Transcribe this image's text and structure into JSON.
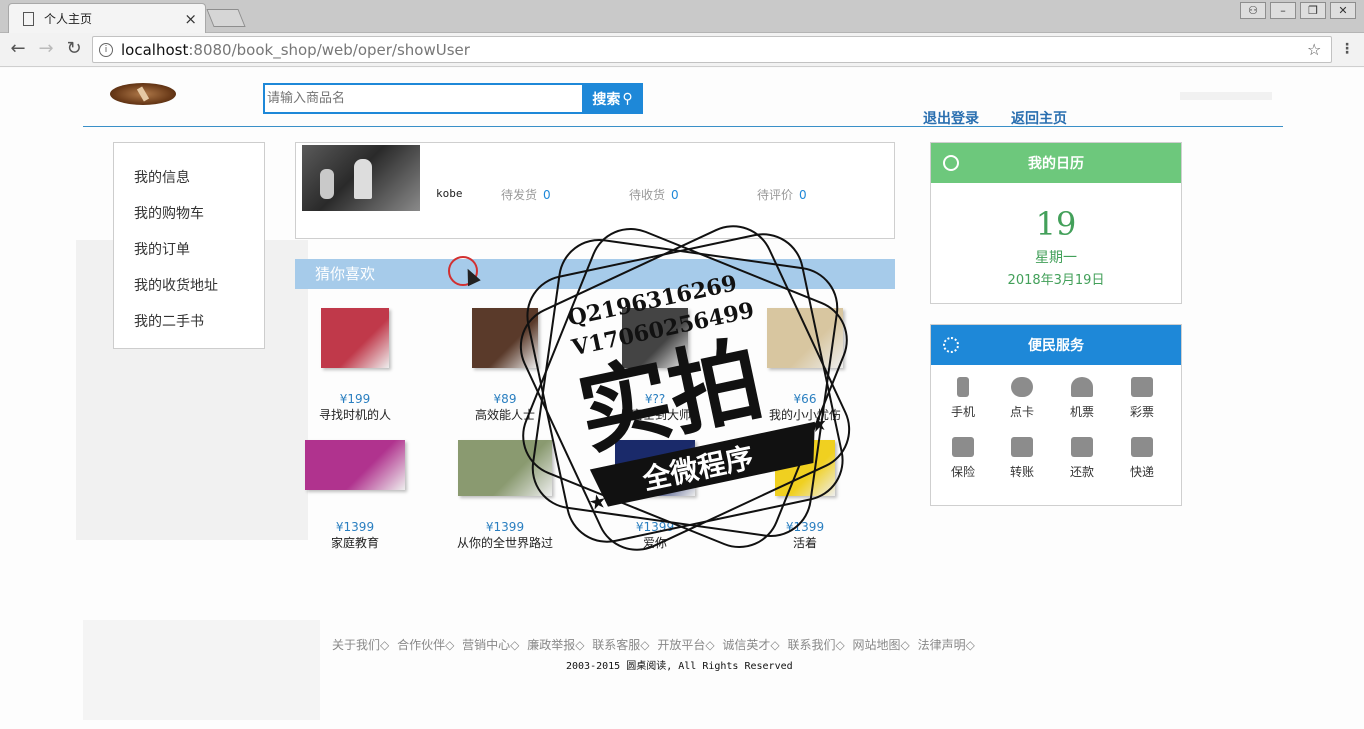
{
  "browser": {
    "tab_title": "个人主页",
    "tab_close": "×",
    "url_host": "localhost",
    "url_path": ":8080/book_shop/web/oper/showUser"
  },
  "header": {
    "search_placeholder": "请输入商品名",
    "search_button": "搜索",
    "logout": "退出登录",
    "home": "返回主页"
  },
  "sidebar": {
    "items": [
      {
        "label": "我的信息"
      },
      {
        "label": "我的购物车"
      },
      {
        "label": "我的订单"
      },
      {
        "label": "我的收货地址"
      },
      {
        "label": "我的二手书"
      }
    ]
  },
  "profile": {
    "username": "kobe",
    "stats": [
      {
        "label": "待发货",
        "count": "0"
      },
      {
        "label": "待收货",
        "count": "0"
      },
      {
        "label": "待评价",
        "count": "0"
      }
    ]
  },
  "guess": {
    "title": "猜你喜欢",
    "products": [
      {
        "price": "¥199",
        "name": "寻找时机的人",
        "color": "#c0394a"
      },
      {
        "price": "¥89",
        "name": "高效能人士",
        "color": "#5a3a2a"
      },
      {
        "price": "¥??",
        "name": "从富士到大师",
        "color": "#444444"
      },
      {
        "price": "¥66",
        "name": "我的小小忧伤",
        "color": "#d8c6a0"
      },
      {
        "price": "¥1399",
        "name": "家庭教育",
        "color": "#b0338e"
      },
      {
        "price": "¥1399",
        "name": "从你的全世界路过",
        "color": "#8a9a70"
      },
      {
        "price": "¥1399",
        "name": "爱你",
        "color": "#1a2a6a"
      },
      {
        "price": "¥1399",
        "name": "活着",
        "color": "#f0d020"
      }
    ]
  },
  "calendar": {
    "title": "我的日历",
    "day": "19",
    "weekday": "星期一",
    "date": "2018年3月19日",
    "accent": "#6dc87c"
  },
  "services": {
    "title": "便民服务",
    "accent": "#1e88d8",
    "items": [
      {
        "label": "手机"
      },
      {
        "label": "点卡"
      },
      {
        "label": "机票"
      },
      {
        "label": "彩票"
      },
      {
        "label": "保险"
      },
      {
        "label": "转账"
      },
      {
        "label": "还款"
      },
      {
        "label": "快递"
      }
    ]
  },
  "footer": {
    "links": [
      "关于我们◇",
      "合作伙伴◇",
      "营销中心◇",
      "廉政举报◇",
      "联系客服◇",
      "开放平台◇",
      "诚信英才◇",
      "联系我们◇",
      "网站地图◇",
      "法律声明◇"
    ],
    "copyright": "2003-2015 圆桌阅读, All Rights Reserved"
  },
  "watermark": {
    "line1": "Q2196316269",
    "line2": "V17060256499",
    "big": "实拍",
    "ribbon": "全微程序"
  }
}
